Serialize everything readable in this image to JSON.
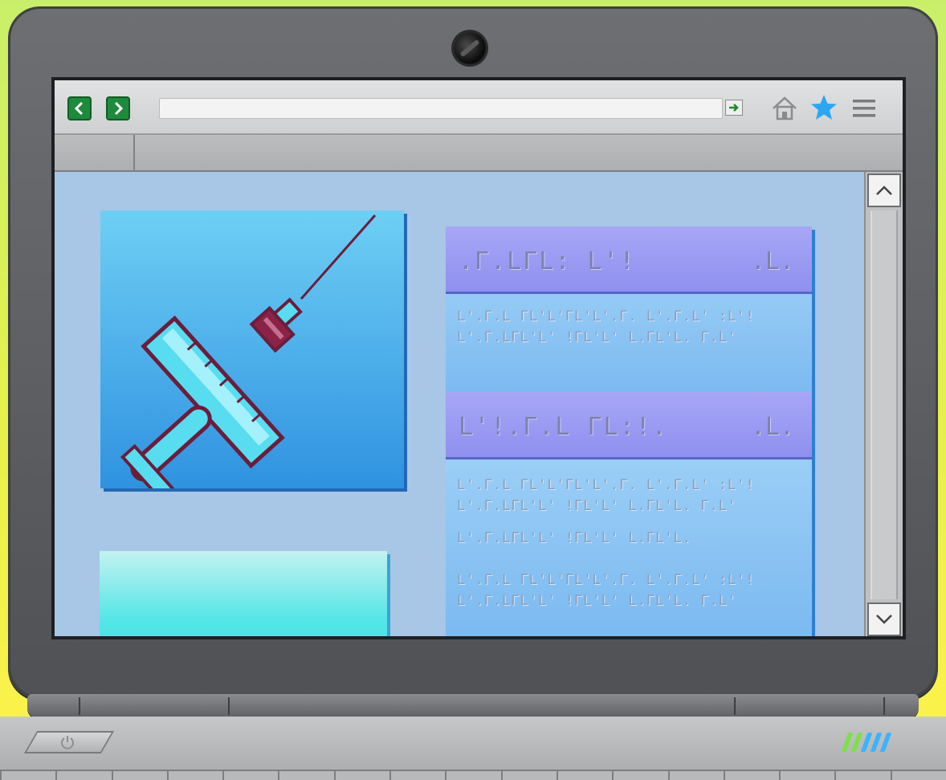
{
  "browser": {
    "url": "",
    "tabs": [
      ""
    ]
  },
  "content": {
    "cards": [
      {
        "title": ".Γ.LΓL: L'!",
        "mark": ".L.",
        "lines": [
          "L'.Γ.L ΓL'L'ΓL'L'.Γ.  L'.Γ.L'  :L'!",
          "L'.Γ.LΓL'L' !ΓL'L' L.ΓL'L.  Γ.L'"
        ]
      },
      {
        "title": "L'!.Γ.L  ΓL:!.",
        "mark": ".L.",
        "lines": [
          "L'.Γ.L ΓL'L'ΓL'L'.Γ.  L'.Γ.L'  :L'!",
          "L'.Γ.LΓL'L' !ΓL'L' L.ΓL'L.  Γ.L'",
          "L'.Γ.LΓL'L' !ΓL'L' L.ΓL'L.",
          "L'.Γ.L ΓL'L'ΓL'L'.Γ.  L'.Γ.L'  :L'!",
          "L'.Γ.LΓL'L' !ΓL'L' L.ΓL'L.  Γ.L'"
        ]
      }
    ]
  },
  "icons": {
    "back": "chevron-left-icon",
    "forward": "chevron-right-icon",
    "go": "arrow-right-icon",
    "home": "home-icon",
    "bookmark": "star-icon",
    "menu": "hamburger-menu-icon",
    "scroll_up": "chevron-up-icon",
    "scroll_down": "chevron-down-icon",
    "power": "power-icon",
    "hero": "syringe-icon"
  },
  "colors": {
    "background_top": "#c9ef6a",
    "background_bottom": "#fff24a",
    "nav_button": "#1e8a3c",
    "star": "#2aa6f2",
    "page_bg": "#a8c6e6",
    "card_header": "#9a9af3",
    "syringe_outline": "#6b1d3c",
    "syringe_barrel": "#58dcf0"
  },
  "indicators": {
    "status_leds": [
      "#7ee04a",
      "#7ee04a",
      "#3ab4ff",
      "#3ab4ff",
      "#3ab4ff"
    ]
  }
}
